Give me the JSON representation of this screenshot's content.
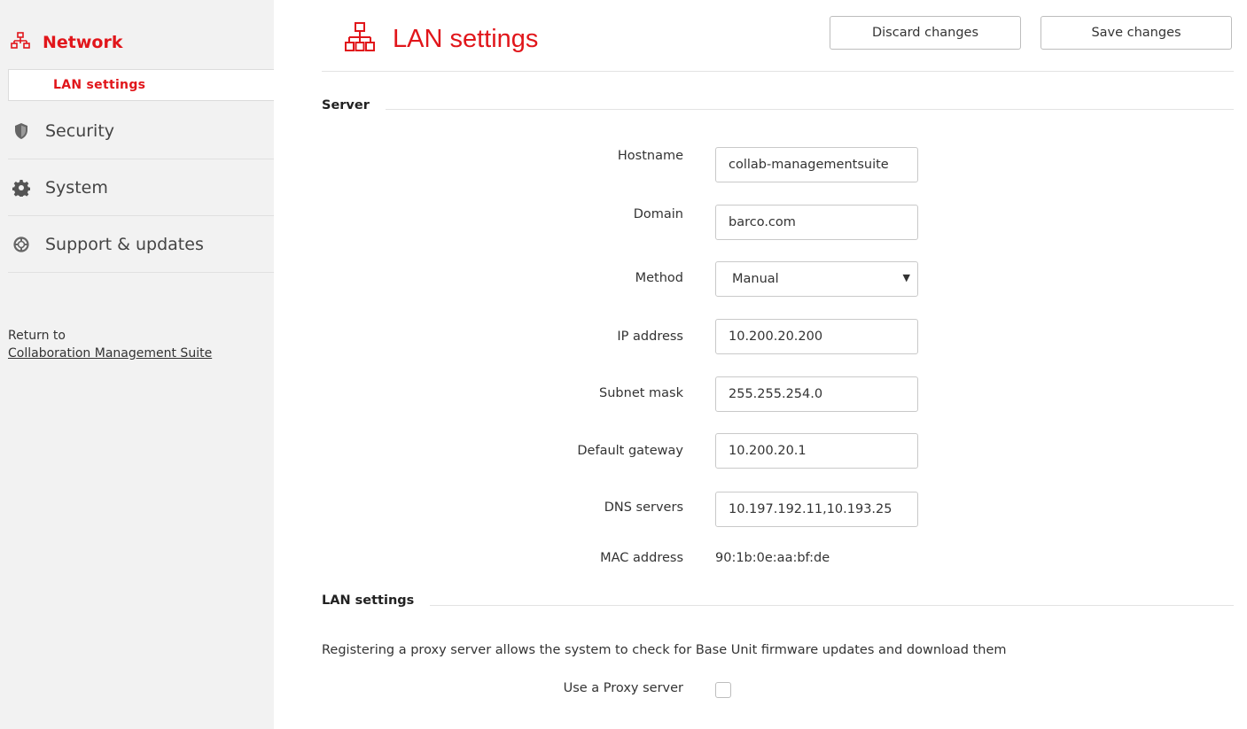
{
  "sidebar": {
    "network": {
      "label": "Network",
      "icon": "network-icon"
    },
    "active_subitem": {
      "label": "LAN settings"
    },
    "items": [
      {
        "label": "Security",
        "icon": "shield-icon"
      },
      {
        "label": "System",
        "icon": "gear-icon"
      },
      {
        "label": "Support & updates",
        "icon": "lifebuoy-icon"
      }
    ],
    "return_text": "Return to",
    "return_link": "Collaboration Management Suite"
  },
  "header": {
    "title": "LAN settings",
    "icon": "network-icon",
    "discard_label": "Discard changes",
    "save_label": "Save changes"
  },
  "server": {
    "title": "Server",
    "hostname": {
      "label": "Hostname",
      "value": "collab-managementsuite"
    },
    "domain": {
      "label": "Domain",
      "value": "barco.com"
    },
    "method": {
      "label": "Method",
      "value": "Manual"
    },
    "ip": {
      "label": "IP address",
      "value": "10.200.20.200"
    },
    "subnet": {
      "label": "Subnet mask",
      "value": "255.255.254.0"
    },
    "gateway": {
      "label": "Default gateway",
      "value": "10.200.20.1"
    },
    "dns": {
      "label": "DNS servers",
      "value": "10.197.192.11,10.193.25"
    },
    "mac": {
      "label": "MAC address",
      "value": "90:1b:0e:aa:bf:de"
    }
  },
  "lan": {
    "title": "LAN settings",
    "description": "Registering a proxy server allows the system to check for Base Unit firmware updates and download them",
    "proxy_label": "Use a Proxy server",
    "proxy_checked": false
  },
  "colors": {
    "accent": "#e1161b",
    "sidebar_bg": "#f2f2f2",
    "border": "#c9c9c9"
  }
}
